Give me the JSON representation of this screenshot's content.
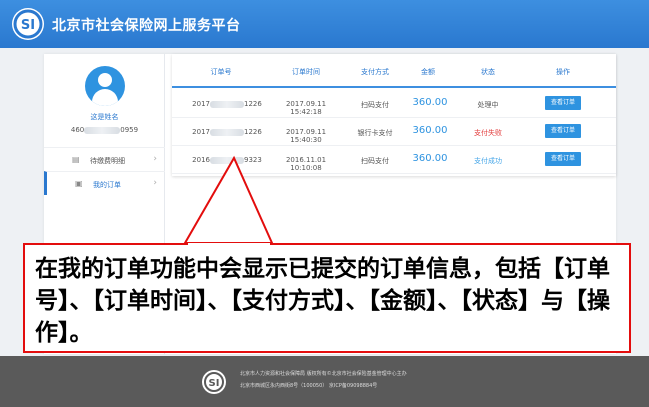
{
  "header": {
    "title": "北京市社会保险网上服务平台"
  },
  "sidebar": {
    "user_name": "这是姓名",
    "user_id_prefix": "460",
    "user_id_suffix": "0959",
    "items": [
      {
        "label": "待缴费明细",
        "icon": "list-icon"
      },
      {
        "label": "我的订单",
        "icon": "document-icon"
      }
    ]
  },
  "orders": {
    "columns": [
      "订单号",
      "订单时间",
      "支付方式",
      "金额",
      "状态",
      "操作"
    ],
    "rows": [
      {
        "order_prefix": "2017",
        "order_suffix": "1226",
        "time": "2017.09.11 15:42:18",
        "payment": "扫码支付",
        "amount": "360.00",
        "status": "处理中",
        "action": "查看订单"
      },
      {
        "order_prefix": "2017",
        "order_suffix": "1226",
        "time": "2017.09.11 15:40:30",
        "payment": "银行卡支付",
        "amount": "360.00",
        "status": "支付失败",
        "action": "查看订单"
      },
      {
        "order_prefix": "2016",
        "order_suffix": "9323",
        "time": "2016.11.01 10:10:08",
        "payment": "扫码支付",
        "amount": "360.00",
        "status": "支付成功",
        "action": "查看订单"
      }
    ]
  },
  "annotation": {
    "text": "在我的订单功能中会显示已提交的订单信息，包括【订单号】、【订单时间】、【支付方式】、【金额】、【状态】与【操作】。"
  },
  "footer": {
    "line1": "北京市人力资源和社会保障局  版权所有©北京市社会保险基金管理中心主办",
    "line2": "北京市西城区永内西街8号（100050）  京ICP备09098884号"
  },
  "colors": {
    "brand_blue": "#2a78cf",
    "accent_red": "#e30d0d",
    "status_fail": "#e23a3a"
  }
}
